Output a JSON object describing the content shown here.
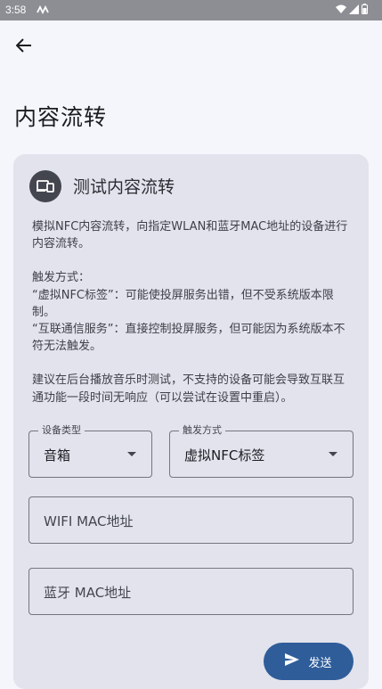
{
  "status_bar": {
    "time": "3:58",
    "notification_icon": "waveform-icon",
    "wifi_icon": "wifi-icon",
    "signal_icon": "signal-icon",
    "battery_icon": "battery-icon"
  },
  "header": {
    "back_icon": "arrow-back-icon",
    "title": "内容流转"
  },
  "card": {
    "icon": "devices-icon",
    "title": "测试内容流转",
    "paragraphs": [
      "模拟NFC内容流转，向指定WLAN和蓝牙MAC地址的设备进行内容流转。",
      "触发方式：\n“虚拟NFC标签”：可能使投屏服务出错，但不受系统版本限制。\n“互联通信服务”：直接控制投屏服务，但可能因为系统版本不符无法触发。",
      "建议在后台播放音乐时测试，不支持的设备可能会导致互联互通功能一段时间无响应（可以尝试在设置中重启）。"
    ]
  },
  "form": {
    "device_type": {
      "label": "设备类型",
      "value": "音箱"
    },
    "trigger_mode": {
      "label": "触发方式",
      "value": "虚拟NFC标签"
    },
    "wifi_mac": {
      "placeholder": "WIFI MAC地址"
    },
    "bluetooth_mac": {
      "placeholder": "蓝牙 MAC地址"
    }
  },
  "actions": {
    "send_label": "发送",
    "send_icon": "send-icon"
  },
  "colors": {
    "background": "#f5f6fb",
    "card": "#e2e3ec",
    "accent": "#2e5d9a",
    "status_bar": "#8d8e94"
  }
}
